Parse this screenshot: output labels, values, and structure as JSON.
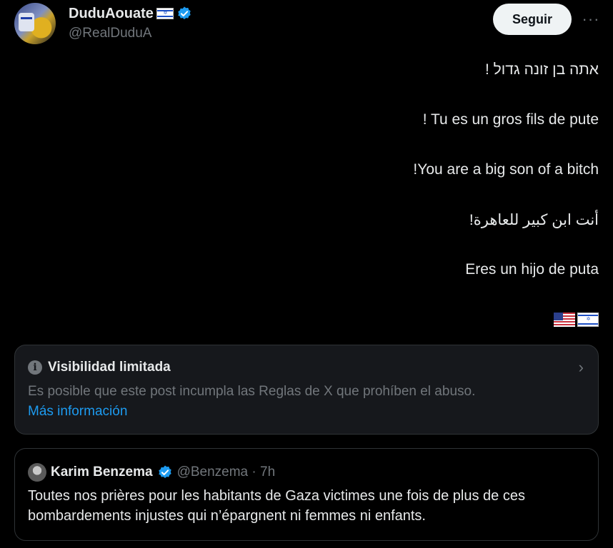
{
  "author": {
    "display_name": "DuduAouate",
    "handle": "@RealDuduA",
    "verified": true
  },
  "actions": {
    "follow_label": "Seguir",
    "more_label": "···"
  },
  "tweet": {
    "lines": [
      "אתה בן זונה גדול !",
      "! Tu es un gros fils de pute",
      "!You are a big son of a bitch",
      "أنت ابن كبير للعاهرة!",
      "Eres un hijo de puta"
    ],
    "flags": [
      "us-flag-icon",
      "israel-flag-icon"
    ]
  },
  "visibility_notice": {
    "title": "Visibilidad limitada",
    "description": "Es posible que este post incumpla las Reglas de X que prohíben el abuso.",
    "link": "Más información",
    "icon": "info-icon"
  },
  "quoted_post": {
    "display_name": "Karim Benzema",
    "handle_time": "@Benzema · 7h",
    "text": "Toutes nos prières pour les habitants de Gaza victimes une fois de plus de ces bombardements injustes qui n’épargnent ni femmes ni enfants."
  },
  "colors": {
    "background": "#000000",
    "text_primary": "#e7e9ea",
    "text_secondary": "#71767b",
    "link": "#1d9bf0",
    "verified": "#1d9bf0",
    "card_border": "#2f3336"
  }
}
